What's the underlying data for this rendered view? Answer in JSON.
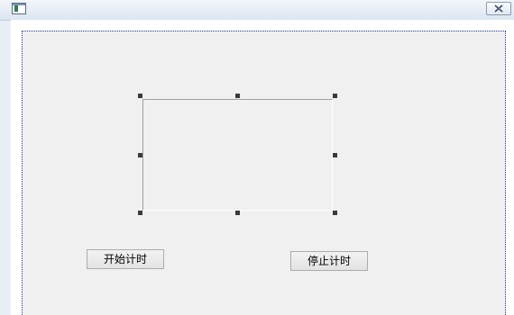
{
  "window": {
    "icon": "app-window-icon",
    "close_icon": "close-icon"
  },
  "form": {
    "selected_control": "group-box",
    "start_button": {
      "label": "开始计时"
    },
    "stop_button": {
      "label": "停止计时"
    }
  }
}
